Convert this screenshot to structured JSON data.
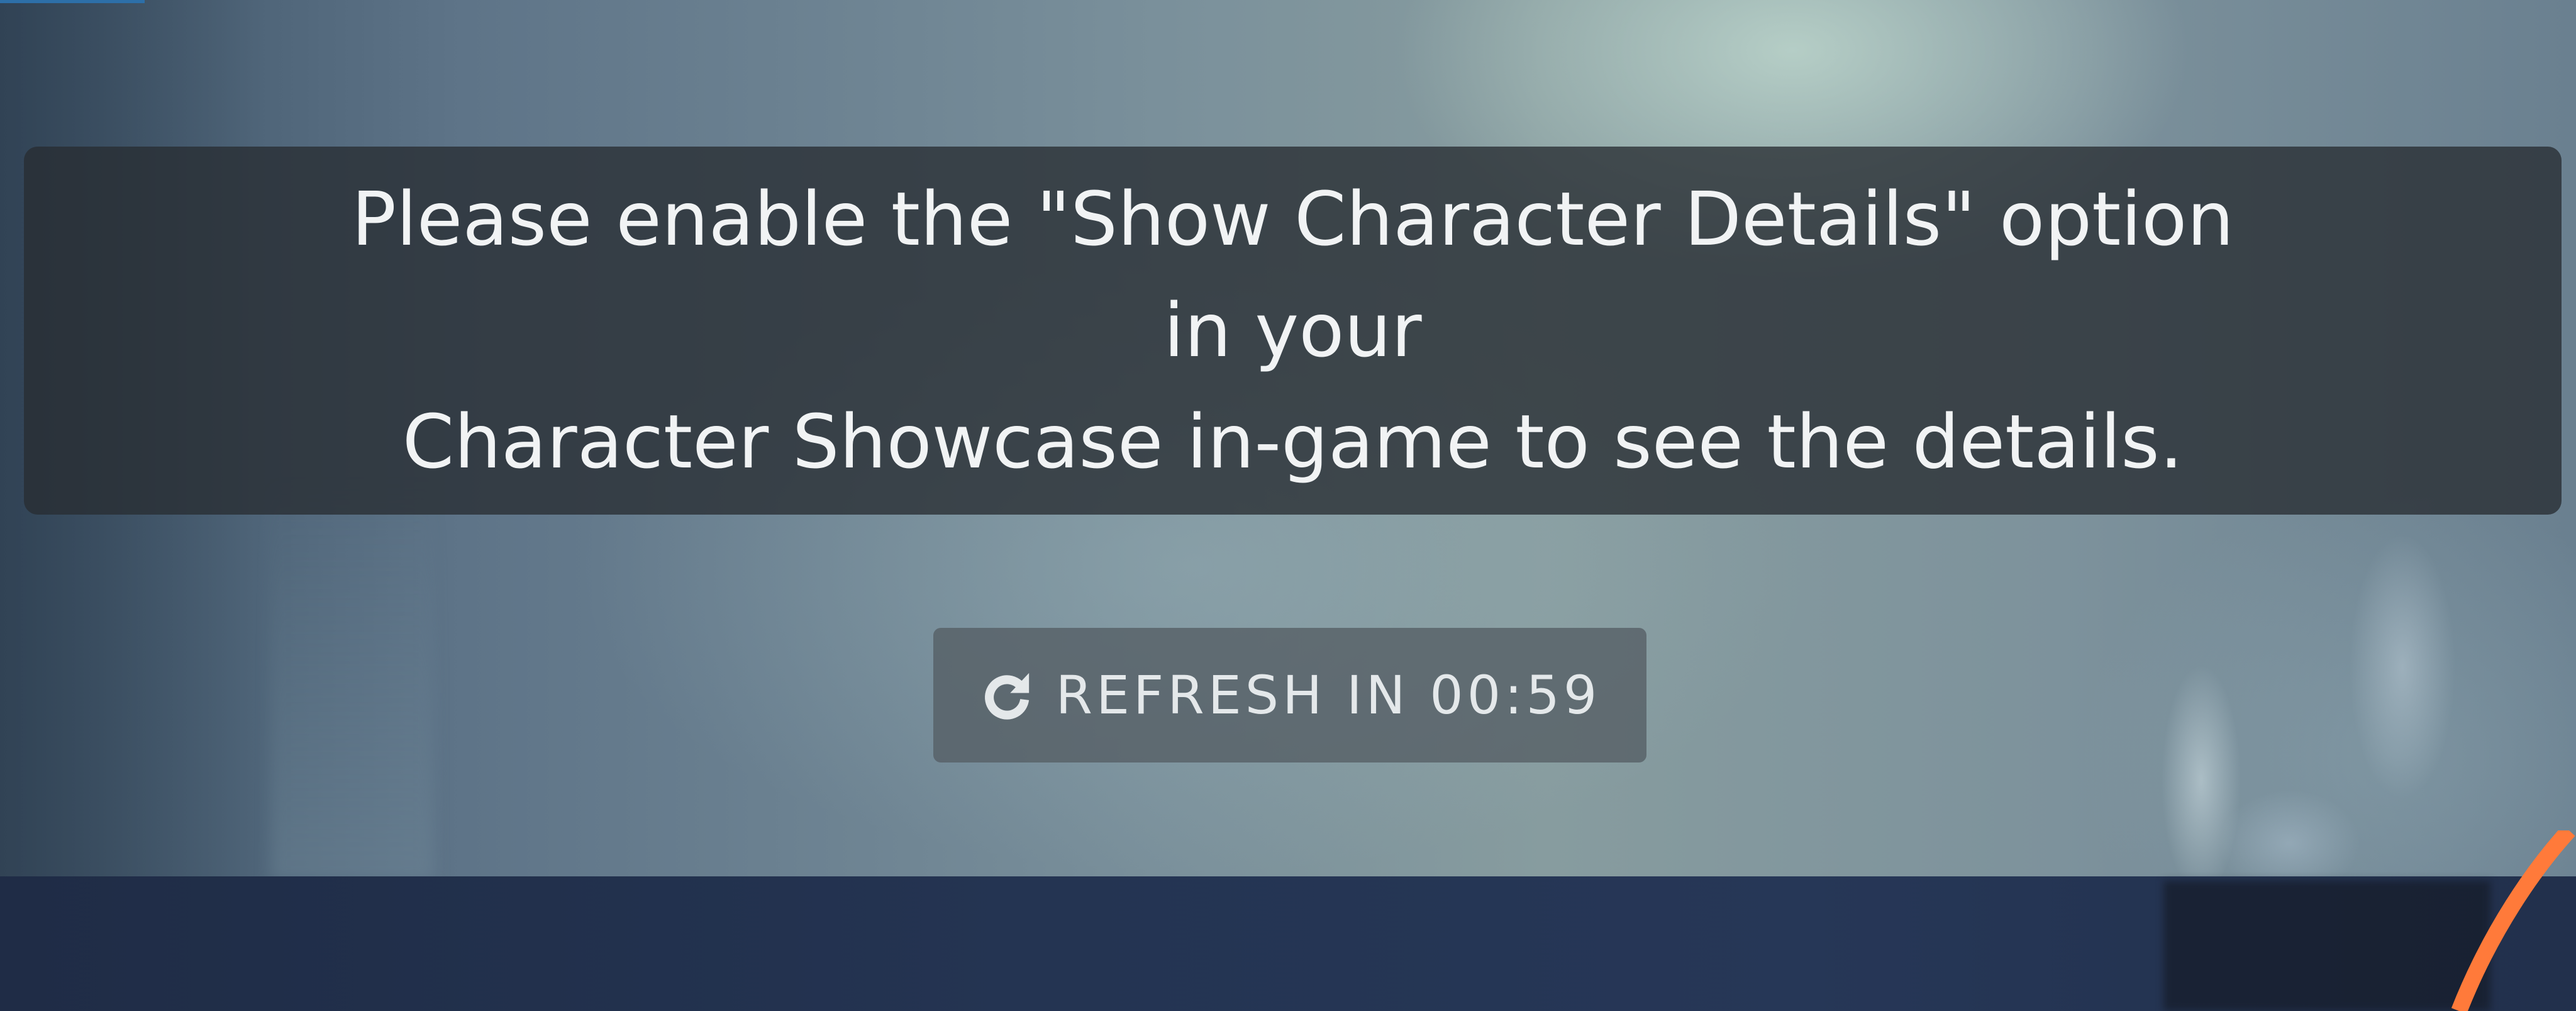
{
  "notice": {
    "line1": "Please enable the \"Show Character Details\" option in your",
    "line2": "Character Showcase in-game to see the details."
  },
  "refresh_button": {
    "icon": "refresh-icon",
    "label": "REFRESH IN 00:59"
  },
  "colors": {
    "panel_bg": "#2a2f34",
    "text": "#f1f3f4",
    "button_bg": "#555e64",
    "bottom_bar": "#243452",
    "accent_orange": "#ff7a3a",
    "accent_blue": "#2d6fa8"
  }
}
